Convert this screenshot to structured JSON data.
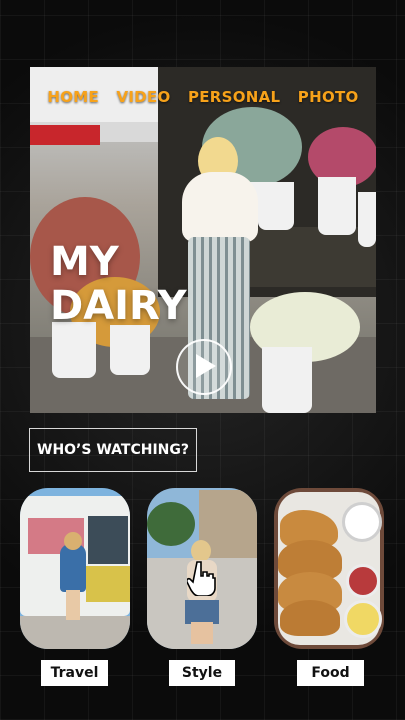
{
  "nav": {
    "items": [
      "HOME",
      "VIDEO",
      "PERSONAL",
      "PHOTO"
    ],
    "color": "#f7a21a"
  },
  "hero": {
    "title_line1": "MY",
    "title_line2": "DAIRY",
    "play_icon": "play-icon"
  },
  "who_watching": "WHO’S WATCHING?",
  "profiles": [
    {
      "label": "Travel",
      "image": "ice-cream-truck-photo"
    },
    {
      "label": "Style",
      "image": "street-fashion-photo"
    },
    {
      "label": "Food",
      "image": "waffles-breakfast-photo"
    }
  ],
  "cursor_icon": "hand-pointer-icon",
  "colors": {
    "background": "#0b0b0b",
    "accent": "#f7a21a",
    "text": "#ffffff"
  }
}
